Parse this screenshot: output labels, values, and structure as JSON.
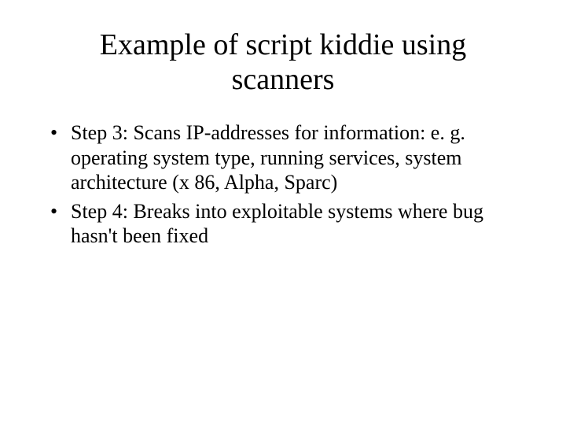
{
  "slide": {
    "title": "Example of script kiddie using scanners",
    "bullets": [
      {
        "text": "Step 3: Scans IP-addresses for information: e. g. operating system type, running services, system architecture (x 86, Alpha, Sparc)"
      },
      {
        "text": "Step 4: Breaks into exploitable systems where bug hasn't been fixed"
      }
    ]
  }
}
